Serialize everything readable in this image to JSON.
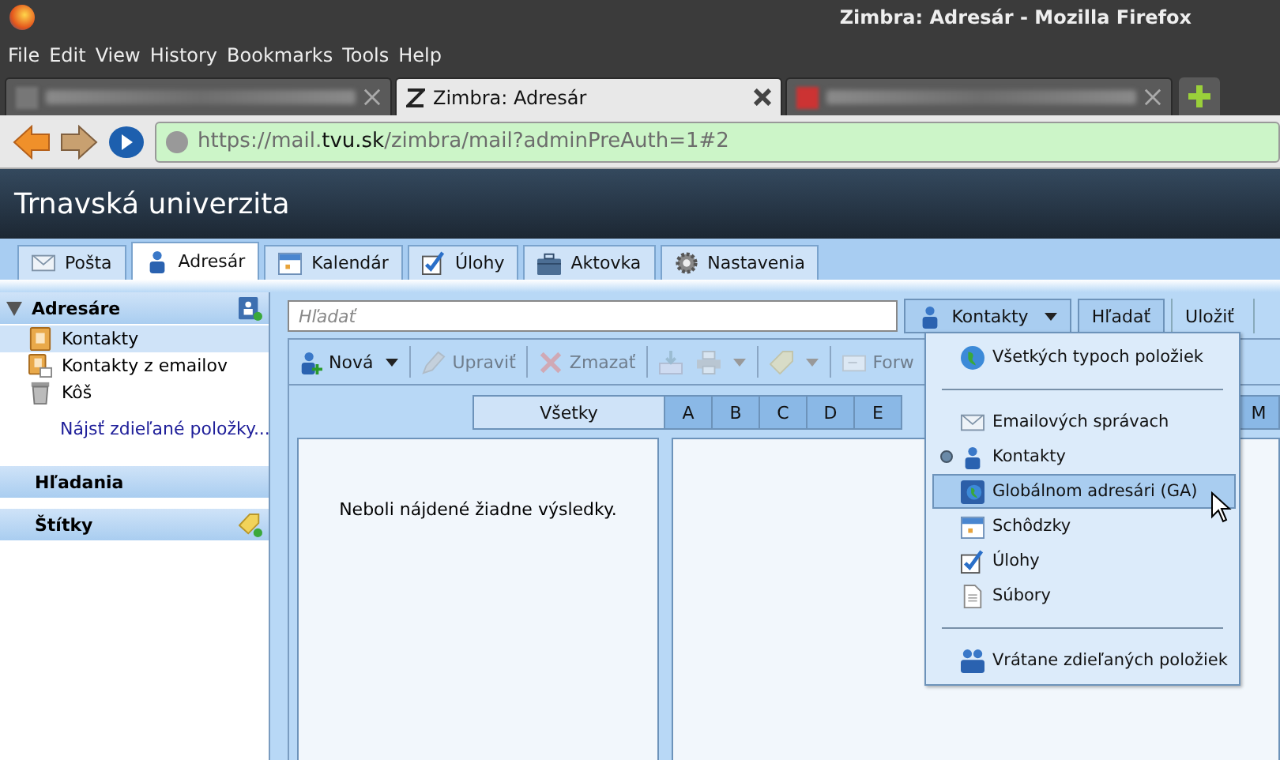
{
  "window": {
    "title": "Zimbra: Adresár - Mozilla Firefox"
  },
  "menubar": [
    "File",
    "Edit",
    "View",
    "History",
    "Bookmarks",
    "Tools",
    "Help"
  ],
  "browser_tabs": [
    {
      "kind": "blurred",
      "selected": false
    },
    {
      "kind": "page",
      "title": "Zimbra: Adresár",
      "selected": true
    },
    {
      "kind": "blurred",
      "selected": false
    }
  ],
  "address_bar": {
    "scheme": "https://mail.",
    "domain": "tvu.sk",
    "path": "/zimbra/mail?adminPreAuth=1#2"
  },
  "brand": "Trnavská univerzita",
  "app_tabs": [
    {
      "label": "Pošta",
      "selected": false
    },
    {
      "label": "Adresár",
      "selected": true
    },
    {
      "label": "Kalendár",
      "selected": false
    },
    {
      "label": "Úlohy",
      "selected": false
    },
    {
      "label": "Aktovka",
      "selected": false
    },
    {
      "label": "Nastavenia",
      "selected": false
    }
  ],
  "sidebar": {
    "sections": [
      {
        "title": "Adresáre",
        "expanded": true,
        "items": [
          {
            "label": "Kontakty",
            "selected": true
          },
          {
            "label": "Kontakty z emailov",
            "selected": false
          },
          {
            "label": "Kôš",
            "selected": false
          }
        ],
        "link": "Nájsť zdieľané položky..."
      },
      {
        "title": "Hľadania"
      },
      {
        "title": "Štítky"
      }
    ]
  },
  "search": {
    "placeholder": "Hľadať",
    "scope": "Kontakty",
    "button": "Hľadať",
    "save": "Uložiť"
  },
  "toolbar": [
    {
      "kind": "button",
      "label": "Nová",
      "disabled": false,
      "dropdown": true
    },
    {
      "kind": "button",
      "label": "Upraviť",
      "disabled": true,
      "dropdown": false
    },
    {
      "kind": "button",
      "label": "Zmazať",
      "disabled": true,
      "dropdown": false
    },
    {
      "kind": "icon",
      "disabled": true,
      "dropdown": false
    },
    {
      "kind": "icon",
      "disabled": true,
      "dropdown": true
    },
    {
      "kind": "icon",
      "disabled": true,
      "dropdown": true
    },
    {
      "kind": "button",
      "label": "Forw",
      "disabled": true,
      "dropdown": false
    }
  ],
  "letters": [
    {
      "label": "Všetky",
      "selected": true
    },
    {
      "label": "A",
      "selected": false
    },
    {
      "label": "B",
      "selected": false
    },
    {
      "label": "C",
      "selected": false
    },
    {
      "label": "D",
      "selected": false
    },
    {
      "label": "E",
      "selected": false
    },
    {
      "label": "M",
      "selected": false
    }
  ],
  "empty_message": "Neboli nájdené žiadne výsledky.",
  "search_menu": [
    {
      "kind": "item",
      "label": "Všetkých typoch položiek",
      "checked": false,
      "selected": false
    },
    {
      "kind": "separator"
    },
    {
      "kind": "item",
      "label": "Emailových správach",
      "checked": false,
      "selected": false
    },
    {
      "kind": "item",
      "label": "Kontakty",
      "checked": true,
      "selected": false
    },
    {
      "kind": "item",
      "label": "Globálnom adresári (GA)",
      "checked": false,
      "selected": true
    },
    {
      "kind": "item",
      "label": "Schôdzky",
      "checked": false,
      "selected": false
    },
    {
      "kind": "item",
      "label": "Úlohy",
      "checked": false,
      "selected": false
    },
    {
      "kind": "item",
      "label": "Súbory",
      "checked": false,
      "selected": false
    },
    {
      "kind": "separator"
    },
    {
      "kind": "item",
      "label": "Vrátane zdieľaných položiek",
      "checked": false,
      "selected": false
    }
  ]
}
